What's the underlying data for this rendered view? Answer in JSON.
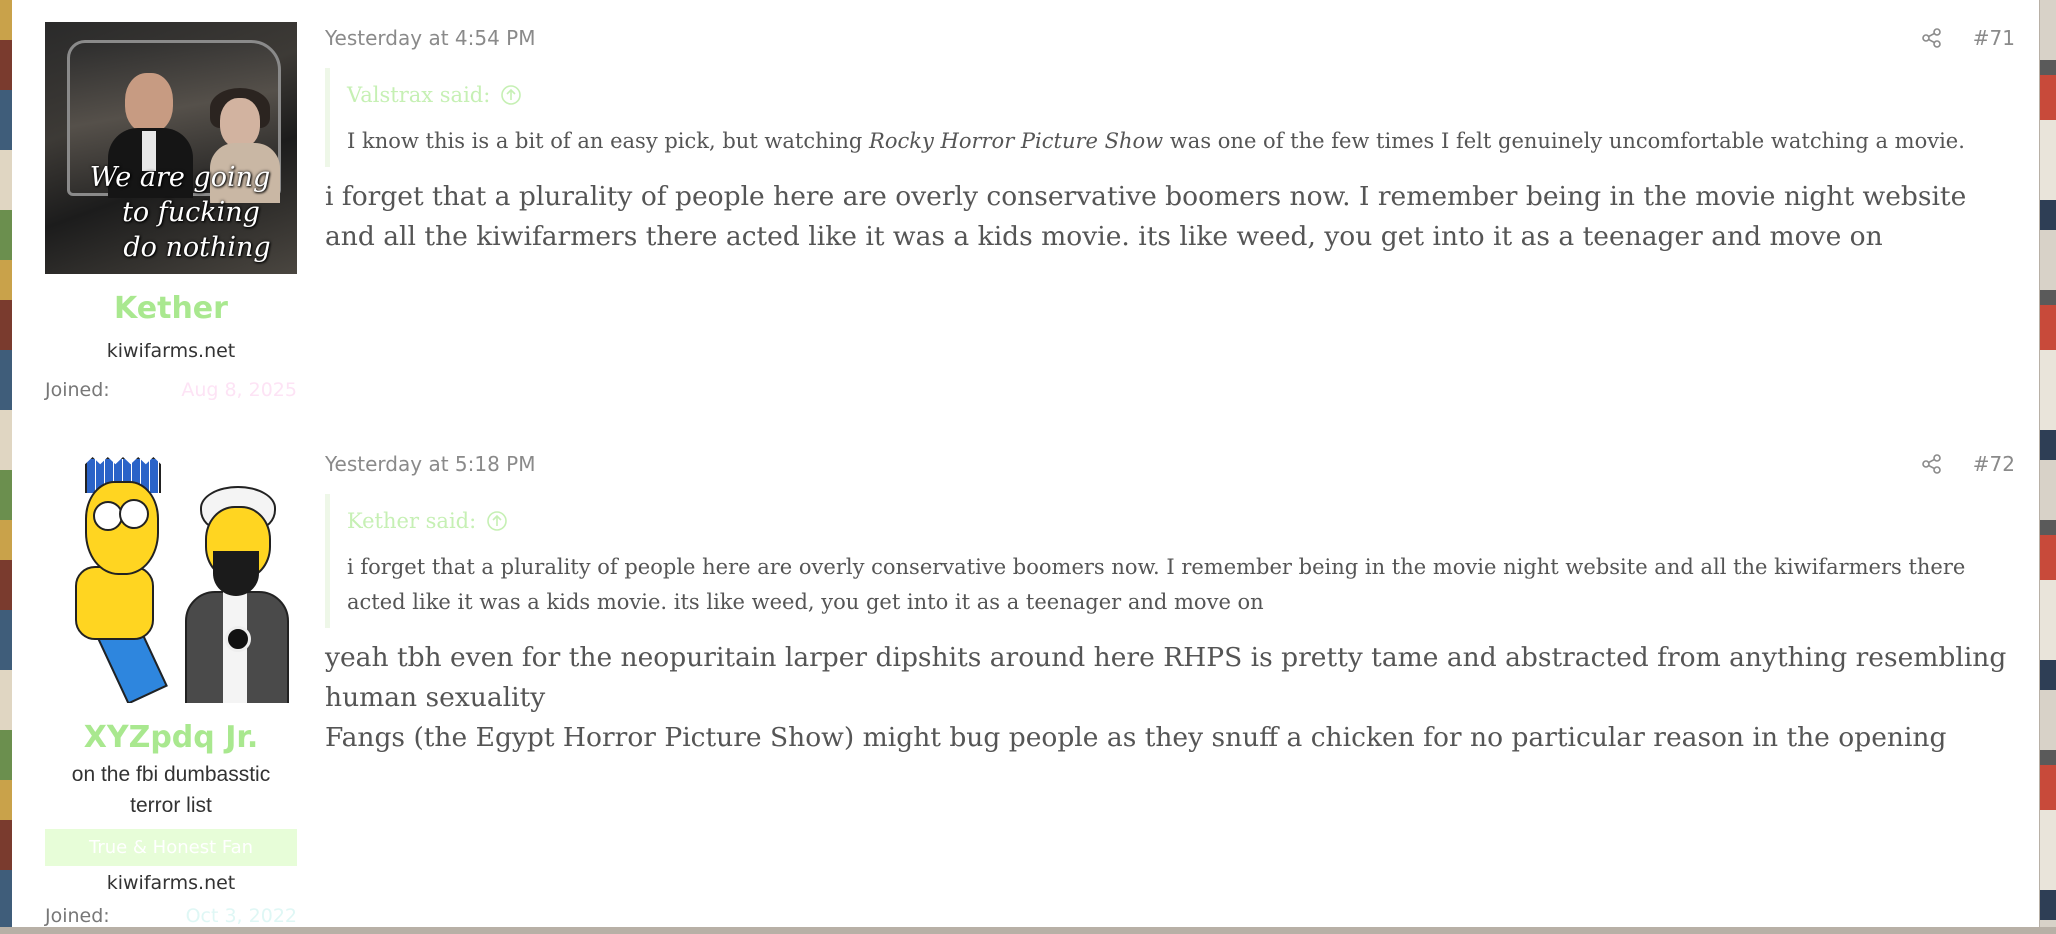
{
  "posts": [
    {
      "username": "Kether",
      "avatar_caption": [
        "We are going",
        "to fucking",
        "do nothing"
      ],
      "site": "kiwifarms.net",
      "joined_label": "Joined:",
      "joined_date": "Aug 8, 2025",
      "timestamp": "Yesterday at 4:54 PM",
      "post_number": "#71",
      "quote": {
        "author": "Valstrax said:",
        "text_before": "I know this is a bit of an easy pick, but watching ",
        "text_italic": "Rocky Horror Picture Show",
        "text_after": " was one of the few times I felt genuinely uncomfortable watching a movie."
      },
      "body": [
        "i forget that a plurality of people here are overly conservative boomers now. I remember being in the movie night website and all the kiwifarmers there acted like it was a kids movie. its like weed, you get into it as a teenager and move on"
      ]
    },
    {
      "username": "XYZpdq Jr.",
      "user_title": "on the fbi dumbasstic terror list",
      "banner": "True & Honest Fan",
      "site": "kiwifarms.net",
      "joined_label": "Joined:",
      "joined_date": "Oct 3, 2022",
      "timestamp": "Yesterday at 5:18 PM",
      "post_number": "#72",
      "quote": {
        "author": "Kether said:",
        "text": "i forget that a plurality of people here are overly conservative boomers now. I remember being in the movie night website and all the kiwifarmers there acted like it was a kids movie. its like weed, you get into it as a teenager and move on"
      },
      "body": [
        "yeah tbh even for the neopuritain larper dipshits around here RHPS is pretty tame and abstracted from anything resembling human sexuality",
        "Fangs (the Egypt Horror Picture Show) might bug people as they snuff a chicken for no particular reason in the opening"
      ]
    }
  ],
  "icons": {
    "share": "share-icon",
    "quote_jump": "arrow-up-circle-icon"
  },
  "colors": {
    "username": "#a9e88f",
    "quote_author": "#c6f0b4",
    "banner_bg": "#e7fdd8",
    "meta_text": "#8a8a8a"
  }
}
